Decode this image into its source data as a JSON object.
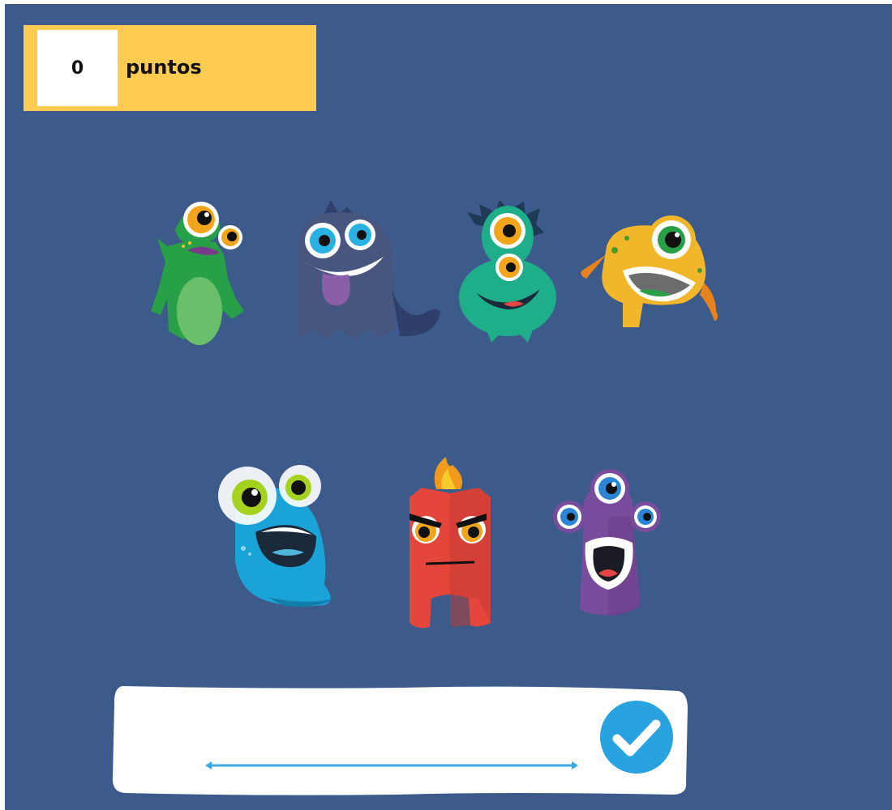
{
  "score": {
    "value": "0",
    "label": "puntos"
  },
  "colors": {
    "background": "#3d5b8a",
    "score_panel": "#fccb4f",
    "check_button": "#29a2e0",
    "answer_line": "#3aa8e6"
  },
  "monsters": [
    {
      "name": "green-two-eyed-monster"
    },
    {
      "name": "dark-blue-tongue-monster"
    },
    {
      "name": "teal-three-eyed-monster"
    },
    {
      "name": "yellow-frog-monster"
    },
    {
      "name": "blue-blob-monster"
    },
    {
      "name": "red-flame-monster"
    },
    {
      "name": "purple-four-eyed-monster"
    }
  ],
  "answer": {
    "value": "",
    "check_icon": "checkmark-icon"
  }
}
